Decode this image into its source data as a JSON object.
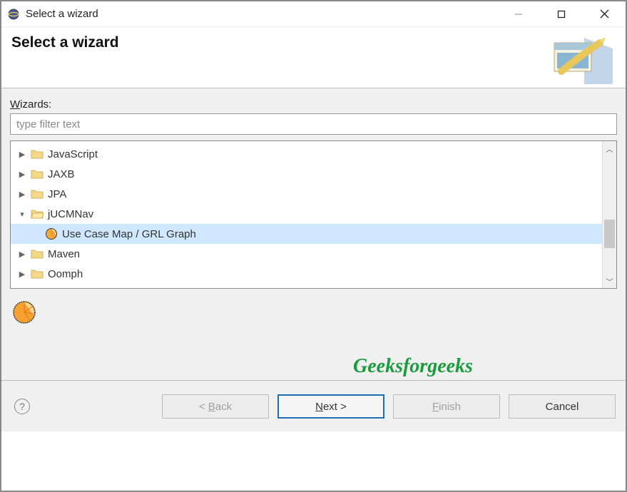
{
  "titlebar": {
    "title": "Select a wizard"
  },
  "banner": {
    "title": "Select a wizard"
  },
  "wizards_label": "Wizards:",
  "filter_placeholder": "type filter text",
  "tree": {
    "items": [
      {
        "label": "JavaScript",
        "expanded": false
      },
      {
        "label": "JAXB",
        "expanded": false
      },
      {
        "label": "JPA",
        "expanded": false
      },
      {
        "label": "jUCMNav",
        "expanded": true,
        "children": [
          {
            "label": "Use Case Map / GRL Graph",
            "selected": true
          }
        ]
      },
      {
        "label": "Maven",
        "expanded": false
      },
      {
        "label": "Oomph",
        "expanded": false
      }
    ]
  },
  "watermark": "Geeksforgeeks",
  "buttons": {
    "back": "< Back",
    "next": "Next >",
    "finish": "Finish",
    "cancel": "Cancel"
  }
}
